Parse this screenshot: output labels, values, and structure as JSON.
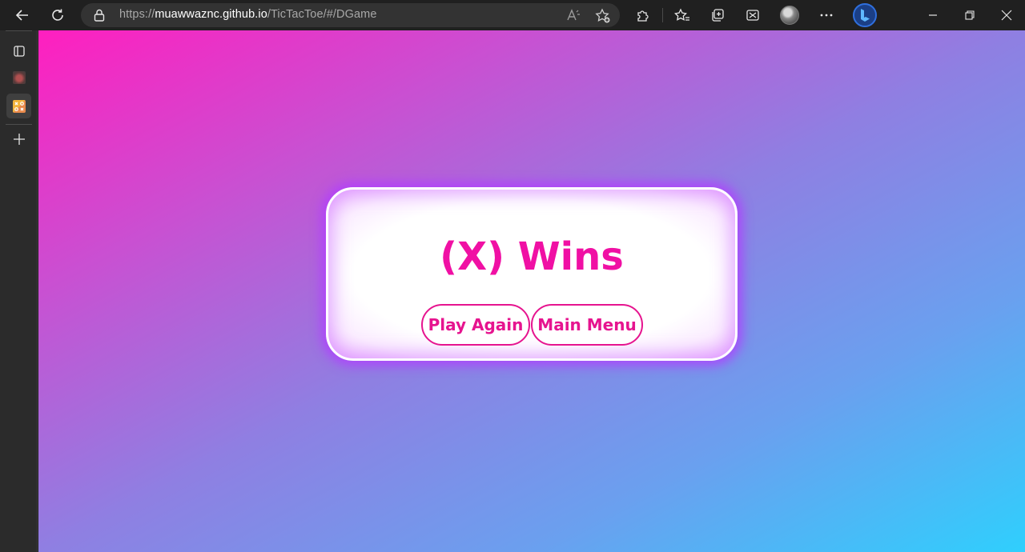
{
  "browser": {
    "url_prefix": "https://",
    "url_host": "muawwaznc.github.io",
    "url_path": "/TicTacToe/#/DGame",
    "icons": [
      "back-icon",
      "refresh-icon",
      "lock-icon",
      "read-aloud-icon",
      "add-favorite-icon",
      "extensions-icon",
      "favorites-icon",
      "collections-icon",
      "web-capture-icon",
      "profile-avatar",
      "more-icon",
      "bing-icon",
      "minimize-icon",
      "restore-icon",
      "close-icon"
    ]
  },
  "sidebar": {
    "items": [
      {
        "name": "tab-actions-icon"
      },
      {
        "name": "tab-1-favicon"
      },
      {
        "name": "tab-2-favicon-tictactoe",
        "active": true
      },
      {
        "name": "new-tab-icon"
      }
    ]
  },
  "game": {
    "result_text": "(X) Wins",
    "play_again_label": "Play Again",
    "main_menu_label": "Main Menu"
  },
  "colors": {
    "accent": "#e6148f",
    "glow": "#b23cff",
    "gradient_start": "#ff1fbf",
    "gradient_end": "#2fcffd"
  }
}
